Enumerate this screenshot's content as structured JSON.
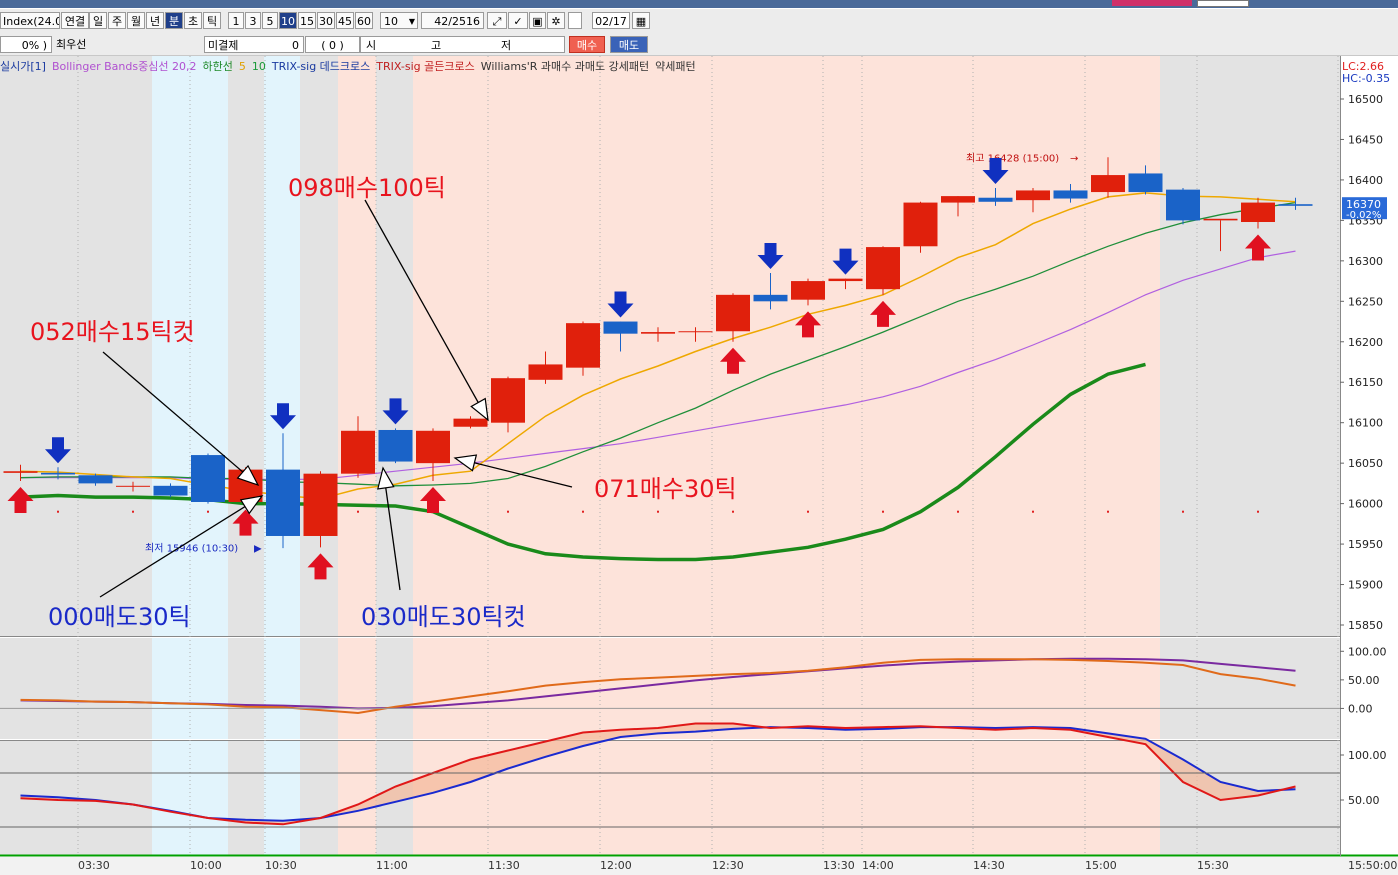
{
  "toolbar": {
    "symbol_input": "Index(24.0",
    "link_label": "연결",
    "periods": [
      "일",
      "주",
      "월",
      "년",
      "분",
      "초",
      "틱"
    ],
    "selected_period": "분",
    "intervals": [
      "1",
      "3",
      "5",
      "10",
      "15",
      "30",
      "45",
      "60"
    ],
    "selected_interval": "10",
    "interval_select": "10",
    "count_display": "42/2516",
    "date_value": "02/17"
  },
  "toolbar2": {
    "percent_label": "0%",
    "best_bid_label": "최우선",
    "unfilled_label": "미결제",
    "unfilled_value": "0",
    "unfilled_paren": "0",
    "ohlc_labels": [
      "시",
      "고",
      "저"
    ],
    "buy_label": "매수",
    "sell_label": "매도"
  },
  "legend": [
    {
      "text": "실시가[1]",
      "color": "#1a3aa0"
    },
    {
      "text": "Bollinger Bands중심선 20,2",
      "color": "#b050d0"
    },
    {
      "text": "하한선",
      "color": "#1f8a2a"
    },
    {
      "text": "5",
      "color": "#e0a000"
    },
    {
      "text": "10",
      "color": "#1a9a3a"
    },
    {
      "text": "TRIX-sig 데드크로스",
      "color": "#1a3aa0"
    },
    {
      "text": "TRIX-sig 골든크로스",
      "color": "#c02020"
    },
    {
      "text": "Williams'R 과매수 과매도 강세패턴",
      "color": "#333333"
    },
    {
      "text": "약세패턴",
      "color": "#333333"
    }
  ],
  "colors": {
    "up": "#e0200c",
    "down": "#1a63c8",
    "ma5": "#eea800",
    "ma10": "#1f8f3a",
    "bb_center": "#b060e0",
    "bb_lower": "#1a8a1a",
    "trix": "#e06a1a",
    "trix_sig": "#7a2aa0",
    "wr_fast": "#e01818",
    "wr_slow": "#1a2ad0",
    "annotation_red": "#e8141e",
    "annotation_blue": "#1a2ac8"
  },
  "chart_data": {
    "type": "candlestick",
    "time_axis_labels": [
      "03:30",
      "10:00",
      "10:30",
      "11:00",
      "11:30",
      "12:00",
      "12:30",
      "13:30",
      "14:00",
      "14:30",
      "15:00",
      "15:30",
      "15:50:00"
    ],
    "price_axis_ticks": [
      16500,
      16450,
      16400,
      16350,
      16300,
      16250,
      16200,
      16150,
      16100,
      16050,
      16000,
      15950,
      15900,
      15850
    ],
    "ylim": [
      15835,
      16520
    ],
    "lc_label": "LC:2.66",
    "hc_label": "HC:-0.35",
    "current_price": "16370",
    "current_change": "-0.02%",
    "high_marker_label": "최고 16428 (15:00)",
    "low_marker_label": "최저 15946 (10:30)",
    "candles": [
      {
        "o": 16038,
        "h": 16048,
        "l": 16028,
        "c": 16040
      },
      {
        "o": 16038,
        "h": 16045,
        "l": 16030,
        "c": 16036
      },
      {
        "o": 16035,
        "h": 16037,
        "l": 16022,
        "c": 16025
      },
      {
        "o": 16022,
        "h": 16027,
        "l": 16015,
        "c": 16022
      },
      {
        "o": 16022,
        "h": 16025,
        "l": 16008,
        "c": 16010
      },
      {
        "o": 16060,
        "h": 16062,
        "l": 16000,
        "c": 16002
      },
      {
        "o": 16002,
        "h": 16045,
        "l": 16000,
        "c": 16042
      },
      {
        "o": 16042,
        "h": 16087,
        "l": 15945,
        "c": 15960
      },
      {
        "o": 15960,
        "h": 16040,
        "l": 15946,
        "c": 16037
      },
      {
        "o": 16037,
        "h": 16108,
        "l": 16032,
        "c": 16090
      },
      {
        "o": 16091,
        "h": 16093,
        "l": 16050,
        "c": 16052
      },
      {
        "o": 16050,
        "h": 16093,
        "l": 16028,
        "c": 16090
      },
      {
        "o": 16095,
        "h": 16108,
        "l": 16093,
        "c": 16105
      },
      {
        "o": 16100,
        "h": 16157,
        "l": 16088,
        "c": 16155
      },
      {
        "o": 16153,
        "h": 16188,
        "l": 16148,
        "c": 16172
      },
      {
        "o": 16168,
        "h": 16225,
        "l": 16158,
        "c": 16223
      },
      {
        "o": 16225,
        "h": 16225,
        "l": 16188,
        "c": 16210
      },
      {
        "o": 16210,
        "h": 16218,
        "l": 16200,
        "c": 16212
      },
      {
        "o": 16212,
        "h": 16218,
        "l": 16200,
        "c": 16213
      },
      {
        "o": 16213,
        "h": 16260,
        "l": 16200,
        "c": 16258
      },
      {
        "o": 16258,
        "h": 16285,
        "l": 16240,
        "c": 16250
      },
      {
        "o": 16252,
        "h": 16278,
        "l": 16245,
        "c": 16275
      },
      {
        "o": 16275,
        "h": 16278,
        "l": 16265,
        "c": 16278
      },
      {
        "o": 16265,
        "h": 16318,
        "l": 16258,
        "c": 16317
      },
      {
        "o": 16318,
        "h": 16373,
        "l": 16310,
        "c": 16372
      },
      {
        "o": 16372,
        "h": 16380,
        "l": 16355,
        "c": 16380
      },
      {
        "o": 16378,
        "h": 16390,
        "l": 16368,
        "c": 16373
      },
      {
        "o": 16375,
        "h": 16390,
        "l": 16360,
        "c": 16387
      },
      {
        "o": 16387,
        "h": 16395,
        "l": 16372,
        "c": 16377
      },
      {
        "o": 16385,
        "h": 16428,
        "l": 16378,
        "c": 16406
      },
      {
        "o": 16408,
        "h": 16418,
        "l": 16382,
        "c": 16385
      },
      {
        "o": 16388,
        "h": 16390,
        "l": 16345,
        "c": 16350
      },
      {
        "o": 16350,
        "h": 16350,
        "l": 16312,
        "c": 16352
      },
      {
        "o": 16348,
        "h": 16378,
        "l": 16340,
        "c": 16372
      },
      {
        "o": 16370,
        "h": 16378,
        "l": 16363,
        "c": 16368
      }
    ],
    "ma5": [
      16040,
      16039,
      16036,
      16033,
      16031,
      16023,
      16016,
      16010,
      16006,
      16018,
      16024,
      16035,
      16040,
      16074,
      16108,
      16134,
      16154,
      16170,
      16188,
      16204,
      16218,
      16234,
      16245,
      16258,
      16280,
      16304,
      16320,
      16346,
      16364,
      16379,
      16384,
      16380,
      16379,
      16376,
      16373
    ],
    "ma10": [
      16032,
      16033,
      16033,
      16033,
      16033,
      16031,
      16031,
      16027,
      16026,
      16024,
      16022,
      16023,
      16025,
      16031,
      16046,
      16064,
      16081,
      16100,
      16118,
      16140,
      16160,
      16177,
      16194,
      16212,
      16231,
      16250,
      16265,
      16281,
      16300,
      16318,
      16334,
      16347,
      16357,
      16365,
      16372
    ],
    "bb_center": [
      16032,
      16032,
      16032,
      16032,
      16032,
      16030,
      16030,
      16030,
      16030,
      16035,
      16040,
      16045,
      16050,
      16056,
      16062,
      16068,
      16074,
      16082,
      16090,
      16098,
      16106,
      16114,
      16122,
      16132,
      16145,
      16162,
      16178,
      16196,
      16215,
      16236,
      16258,
      16276,
      16290,
      16304,
      16312
    ],
    "bb_lower": [
      16008,
      16010,
      16008,
      16008,
      16007,
      16005,
      16000,
      16000,
      15999,
      15998,
      15997,
      15990,
      15970,
      15950,
      15938,
      15934,
      15932,
      15931,
      15931,
      15934,
      15940,
      15946,
      15956,
      15968,
      15990,
      16020,
      16058,
      16098,
      16135,
      16160,
      16172
    ],
    "trix": [
      15,
      14,
      12,
      11,
      9,
      7,
      3,
      2,
      -3,
      -8,
      3,
      12,
      21,
      30,
      40,
      46,
      51,
      54,
      57,
      60,
      62,
      66,
      72,
      80,
      85,
      86,
      86,
      86,
      85,
      83,
      80,
      76,
      60,
      52,
      40
    ],
    "trix_sig": [
      14,
      13,
      12,
      11,
      9,
      8,
      6,
      5,
      3,
      0,
      1,
      4,
      9,
      14,
      21,
      28,
      35,
      42,
      49,
      55,
      60,
      65,
      70,
      75,
      79,
      82,
      84,
      86,
      87,
      87,
      86,
      84,
      78,
      72,
      66
    ],
    "wr_fast": [
      -48,
      -50,
      -51,
      -55,
      -63,
      -70,
      -75,
      -77,
      -70,
      -55,
      -35,
      -20,
      -5,
      5,
      15,
      25,
      28,
      30,
      35,
      35,
      30,
      32,
      30,
      31,
      32,
      30,
      28,
      30,
      28,
      20,
      12,
      -30,
      -50,
      -45,
      -35
    ],
    "wr_slow": [
      -45,
      -47,
      -50,
      -55,
      -62,
      -70,
      -72,
      -73,
      -70,
      -62,
      -52,
      -42,
      -30,
      -15,
      -2,
      10,
      20,
      24,
      26,
      29,
      31,
      30,
      28,
      29,
      31,
      31,
      30,
      31,
      30,
      24,
      18,
      -5,
      -30,
      -40,
      -38
    ],
    "trix_ticks": [
      "100.00",
      "50.00",
      "0.00"
    ],
    "wr_ticks": [
      "100.00",
      "50.00"
    ],
    "buy_arrows": [
      0,
      6,
      8,
      11,
      19,
      21,
      23,
      33
    ],
    "sell_arrows": [
      1,
      7,
      10,
      16,
      20,
      22,
      26
    ],
    "annotations": [
      {
        "text": "098매수100틱",
        "color": "red"
      },
      {
        "text": "052매수15틱컷",
        "color": "red"
      },
      {
        "text": "071매수30틱",
        "color": "red"
      },
      {
        "text": "000매도30틱",
        "color": "blue"
      },
      {
        "text": "030매도30틱컷",
        "color": "blue"
      }
    ]
  }
}
